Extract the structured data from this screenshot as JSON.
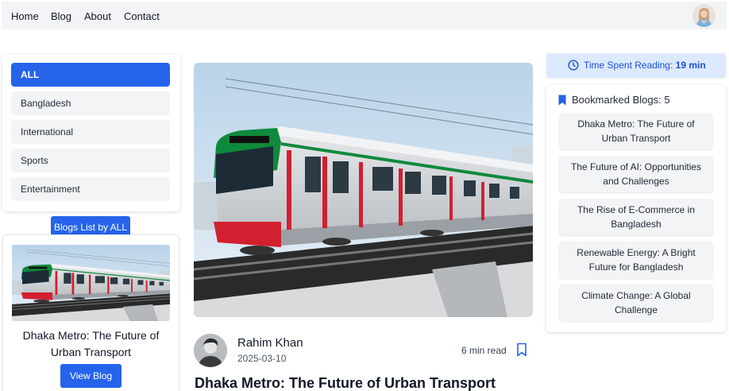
{
  "nav": {
    "links": [
      "Home",
      "Blog",
      "About",
      "Contact"
    ]
  },
  "categories": {
    "items": [
      "ALL",
      "Bangladesh",
      "International",
      "Sports",
      "Entertainment"
    ],
    "active": "ALL"
  },
  "blog_list": {
    "title": "Blogs List by ALL"
  },
  "sidebar_card": {
    "title": "Dhaka Metro: The Future of Urban Transport",
    "button": "View Blog"
  },
  "main_post": {
    "author": "Rahim Khan",
    "date": "2025-03-10",
    "read_time": "6 min read",
    "title": "Dhaka Metro: The Future of Urban Transport"
  },
  "reading": {
    "label": "Time Spent Reading:",
    "value": "19 min"
  },
  "bookmarks": {
    "heading": "Bookmarked Blogs: 5",
    "items": [
      "Dhaka Metro: The Future of Urban Transport",
      "The Future of AI: Opportunities and Challenges",
      "The Rise of E-Commerce in Bangladesh",
      "Renewable Energy: A Bright Future for Bangladesh",
      "Climate Change: A Global Challenge"
    ]
  },
  "colors": {
    "primary": "#2563eb",
    "nav_bg": "#f3f4f6",
    "time_bg": "#dbeafe",
    "train_green": "#0f8a3c",
    "train_red": "#d1202f"
  },
  "icons": {
    "avatar": "user-avatar-icon",
    "clock": "clock-icon",
    "bookmark": "bookmark-icon"
  }
}
